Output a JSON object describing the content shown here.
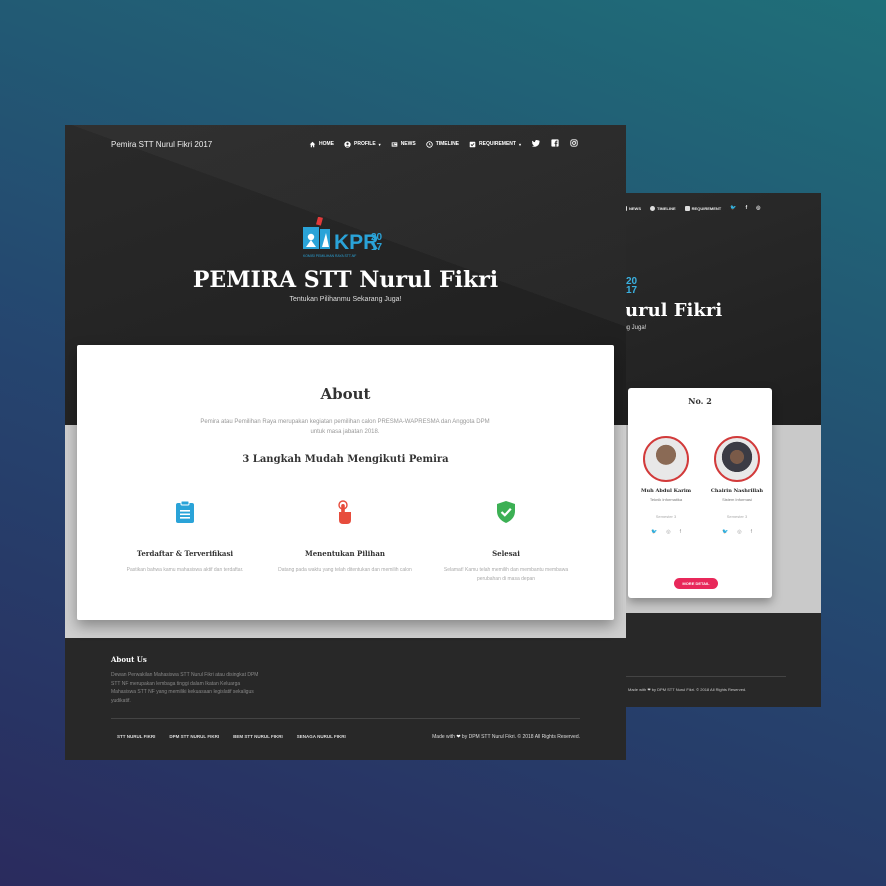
{
  "back": {
    "nav": [
      "NEWS",
      "TIMELINE",
      "REQUIREMENT"
    ],
    "logo_year": "20\n17",
    "title": "urul Fikri",
    "tagline": "ang Juga!",
    "card_title": "No. 2",
    "candidates": [
      {
        "name": "Muh Abdul Karim",
        "program": "Teknik Informatika",
        "semester": "Semester 3"
      },
      {
        "name": "Chairin Nashrillah",
        "program": "Sistem Informasi",
        "semester": "Semester 3"
      }
    ],
    "more_button": "MORE DETAIL",
    "copyright": "Made with ❤ by DPM STT Nurul Fikri. © 2018 All Rights Reserved."
  },
  "front": {
    "brand": "Pemira STT Nurul Fikri 2017",
    "nav": {
      "home": "HOME",
      "profile": "PROFILE",
      "news": "NEWS",
      "timeline": "TIMELINE",
      "requirement": "REQUIREMENT"
    },
    "logo": {
      "text": "KPR",
      "year_top": "20",
      "year_bottom": "17",
      "subtitle": "KOMISI PEMILIHAN RAYA STT-NF"
    },
    "title": "PEMIRA STT Nurul Fikri",
    "tagline": "Tentukan Pilihanmu Sekarang Juga!",
    "about": {
      "heading": "About",
      "description": "Pemira atau Pemilihan Raya merupakan kegiatan pemilihan calon PRESMA-WAPRESMA dan Anggota DPM untuk masa jabatan 2018.",
      "steps_heading": "3 Langkah Mudah Mengikuti Pemira",
      "steps": [
        {
          "icon": "clipboard-icon",
          "title": "Terdaftar & Terverifikasi",
          "desc": "Pastikan bahwa kamu mahasiswa aktif dan terdaftar."
        },
        {
          "icon": "pointer-hand-icon",
          "title": "Menentukan Pilihan",
          "desc": "Datang pada waktu yang telah ditentukan dan memilih calon"
        },
        {
          "icon": "check-shield-icon",
          "title": "Selesai",
          "desc": "Selamat! Kamu telah memilih dan membantu membawa perubahan di masa depan"
        }
      ]
    },
    "footer": {
      "about_heading": "About Us",
      "about_text": "Dewan Perwakilan Mahasiswa STT Nurul Fikri atau disingkat DPM STT NF merupakan lembaga tinggi dalam Ikatan Keluarga Mahasiswa STT NF yang memiliki kekuasaan legislatif sekaligus yudikatif.",
      "links": [
        "STT NURUL FIKRI",
        "DPM STT NURUL FIKRI",
        "BEM STT NURUL FIKRI",
        "SENAGA NURUL FIKRI"
      ],
      "copy_prefix": "Made with",
      "copy_suffix": "by DPM STT Nurul Fikri. © 2018 All Rights Reserved."
    }
  },
  "colors": {
    "accent_blue": "#2aa3d8",
    "accent_red": "#e74c3c",
    "accent_green": "#3cb054",
    "button_pink": "#e8285a"
  }
}
